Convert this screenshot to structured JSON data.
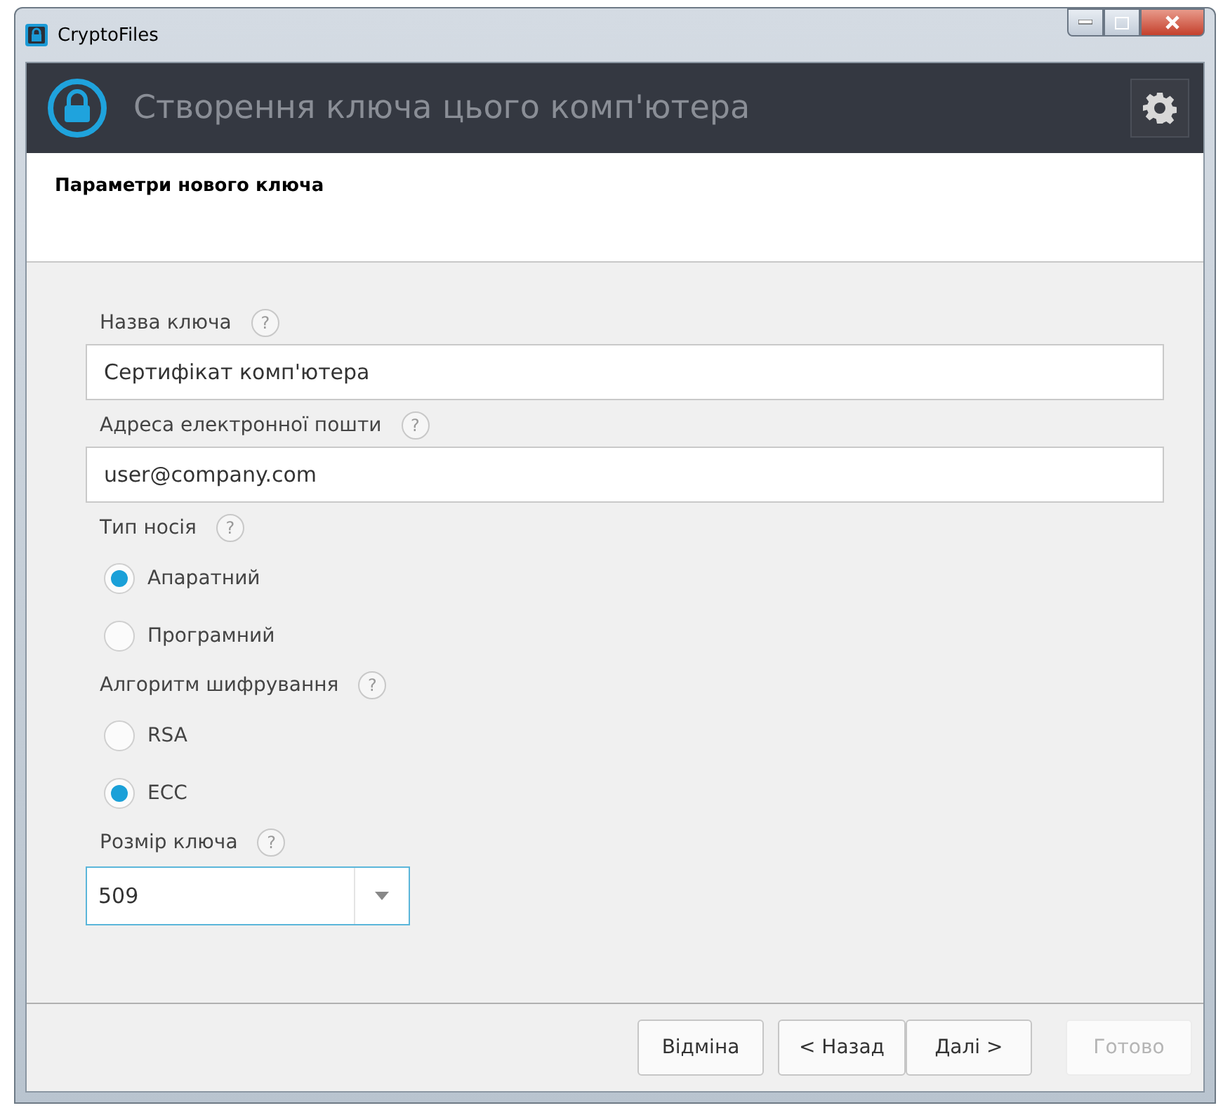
{
  "window": {
    "title": "CryptoFiles"
  },
  "header": {
    "title": "Створення ключа цього комп'ютера"
  },
  "step": {
    "title": "Параметри нового ключа"
  },
  "form": [
    {
      "kind": "text",
      "label": "Назва ключа",
      "help": "?",
      "value": "Сертифікат комп'ютера"
    },
    {
      "kind": "text",
      "label": "Адреса електронної пошти",
      "help": "?",
      "value": "user@company.com"
    },
    {
      "kind": "radio",
      "label": "Тип носія",
      "help": "?",
      "options": [
        {
          "label": "Апаратний",
          "selected": true
        },
        {
          "label": "Програмний",
          "selected": false
        }
      ]
    },
    {
      "kind": "radio",
      "label": "Алгоритм шифрування",
      "help": "?",
      "options": [
        {
          "label": "RSA",
          "selected": false
        },
        {
          "label": "ECC",
          "selected": true
        }
      ]
    },
    {
      "kind": "select",
      "label": "Розмір ключа",
      "help": "?",
      "value": "509"
    }
  ],
  "buttons": [
    {
      "label": "Відміна",
      "disabled": false
    },
    {
      "label": "< Назад",
      "disabled": false
    },
    {
      "label": "Далі >",
      "disabled": false
    },
    {
      "label": "Готово",
      "disabled": true
    }
  ]
}
